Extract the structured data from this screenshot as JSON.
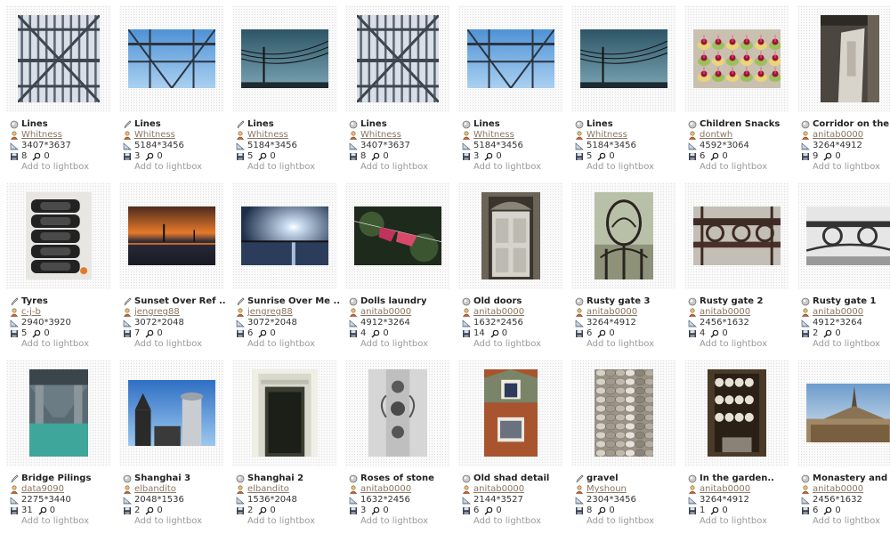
{
  "lightbox_label": "Add to lightbox",
  "icons": {
    "type": "camera-icon",
    "author": "user-icon",
    "dims": "ruler-icon",
    "saves": "floppy-icon",
    "comments": "magnifier-icon"
  },
  "rows": [
    [
      {
        "title": "Lines",
        "author": "Whitness",
        "dims": "3407*3637",
        "saves": "8",
        "comments": "0",
        "type": "round",
        "img": "bridge",
        "w": 92,
        "h": 98
      },
      {
        "title": "Lines",
        "author": "Whitness",
        "dims": "5184*3456",
        "saves": "3",
        "comments": "0",
        "type": "pencil",
        "img": "bridge-sky",
        "w": 98,
        "h": 66
      },
      {
        "title": "Lines",
        "author": "Whitness",
        "dims": "5184*3456",
        "saves": "5",
        "comments": "0",
        "type": "pencil",
        "img": "wires",
        "w": 98,
        "h": 66
      },
      {
        "title": "Lines",
        "author": "Whitness",
        "dims": "3407*3637",
        "saves": "8",
        "comments": "0",
        "type": "round",
        "img": "bridge",
        "w": 92,
        "h": 98
      },
      {
        "title": "Lines",
        "author": "Whitness",
        "dims": "5184*3456",
        "saves": "3",
        "comments": "0",
        "type": "round",
        "img": "bridge-sky",
        "w": 98,
        "h": 66
      },
      {
        "title": "Lines",
        "author": "Whitness",
        "dims": "5184*3456",
        "saves": "5",
        "comments": "0",
        "type": "round",
        "img": "wires",
        "w": 98,
        "h": 66
      },
      {
        "title": "Children Snacks",
        "author": "dontwh",
        "dims": "4592*3064",
        "saves": "6",
        "comments": "0",
        "type": "round",
        "img": "snacks",
        "w": 98,
        "h": 66
      },
      {
        "title": "Corridor on the ..",
        "author": "anitab0000",
        "dims": "3264*4912",
        "saves": "9",
        "comments": "0",
        "type": "round",
        "img": "corridor",
        "w": 66,
        "h": 98
      }
    ],
    [
      {
        "title": "Tyres",
        "author": "c-j-b",
        "dims": "2940*3920",
        "saves": "5",
        "comments": "0",
        "type": "pencil",
        "img": "tyres",
        "w": 74,
        "h": 98
      },
      {
        "title": "Sunset Over Ref ..",
        "author": "jengreg88",
        "dims": "3072*2048",
        "saves": "7",
        "comments": "0",
        "type": "pencil",
        "img": "sunset",
        "w": 98,
        "h": 66
      },
      {
        "title": "Sunrise Over Me ..",
        "author": "jengreg88",
        "dims": "3072*2048",
        "saves": "6",
        "comments": "0",
        "type": "pencil",
        "img": "sunrise",
        "w": 98,
        "h": 66
      },
      {
        "title": "Dolls laundry",
        "author": "anitab0000",
        "dims": "4912*3264",
        "saves": "4",
        "comments": "0",
        "type": "round",
        "img": "laundry",
        "w": 98,
        "h": 66
      },
      {
        "title": "Old doors",
        "author": "anitab0000",
        "dims": "1632*2456",
        "saves": "14",
        "comments": "0",
        "type": "round",
        "img": "door",
        "w": 66,
        "h": 98
      },
      {
        "title": "Rusty gate 3",
        "author": "anitab0000",
        "dims": "3264*4912",
        "saves": "6",
        "comments": "0",
        "type": "round",
        "img": "gate-oval",
        "w": 66,
        "h": 98
      },
      {
        "title": "Rusty gate 2",
        "author": "anitab0000",
        "dims": "2456*1632",
        "saves": "4",
        "comments": "0",
        "type": "round",
        "img": "gate",
        "w": 98,
        "h": 66
      },
      {
        "title": "Rusty gate 1",
        "author": "anitab0000",
        "dims": "4912*3264",
        "saves": "2",
        "comments": "0",
        "type": "round",
        "img": "gate-bw",
        "w": 98,
        "h": 66
      }
    ],
    [
      {
        "title": "Bridge Pilings",
        "author": "data9090",
        "dims": "2275*3440",
        "saves": "31",
        "comments": "0",
        "type": "pencil",
        "img": "pilings",
        "w": 66,
        "h": 98
      },
      {
        "title": "Shanghai 3",
        "author": "elbandito",
        "dims": "2048*1536",
        "saves": "2",
        "comments": "0",
        "type": "round",
        "img": "shanghai",
        "w": 98,
        "h": 74
      },
      {
        "title": "Shanghai 2",
        "author": "elbandito",
        "dims": "1536*2048",
        "saves": "2",
        "comments": "0",
        "type": "round",
        "img": "shanghai-door",
        "w": 74,
        "h": 98
      },
      {
        "title": "Roses of stone",
        "author": "anitab0000",
        "dims": "1632*2456",
        "saves": "3",
        "comments": "0",
        "type": "round",
        "img": "stone",
        "w": 66,
        "h": 98
      },
      {
        "title": "Old shad detail",
        "author": "anitab0000",
        "dims": "2144*3527",
        "saves": "6",
        "comments": "0",
        "type": "round",
        "img": "house",
        "w": 60,
        "h": 98
      },
      {
        "title": "gravel",
        "author": "Myshoun",
        "dims": "2304*3456",
        "saves": "8",
        "comments": "0",
        "type": "pencil",
        "img": "gravel",
        "w": 66,
        "h": 98
      },
      {
        "title": "In the garden..",
        "author": "anitab0000",
        "dims": "3264*4912",
        "saves": "1",
        "comments": "0",
        "type": "round",
        "img": "garden",
        "w": 66,
        "h": 98
      },
      {
        "title": "Monastery and c ..",
        "author": "anitab0000",
        "dims": "2456*1632",
        "saves": "6",
        "comments": "0",
        "type": "round",
        "img": "monastery",
        "w": 98,
        "h": 66
      }
    ]
  ]
}
